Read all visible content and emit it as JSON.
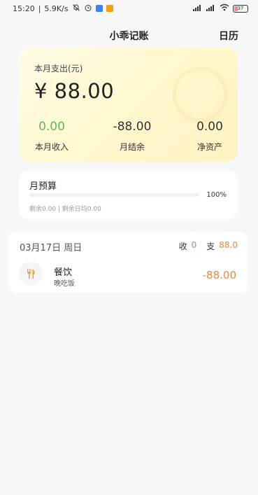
{
  "status_bar": {
    "time": "15:20",
    "speed": "5.9K/s",
    "battery_text": "37",
    "battery_level": 0.37,
    "app_colors": [
      "#3b82f6",
      "#f59e0b"
    ]
  },
  "header": {
    "title": "小乖记账",
    "calendar_label": "日历"
  },
  "summary": {
    "label": "本月支出(元)",
    "amount": "¥ 88.00",
    "income_value": "0.00",
    "income_label": "本月收入",
    "balance_value": "-88.00",
    "balance_label": "月结余",
    "net_value": "0.00",
    "net_label": "净资产"
  },
  "budget": {
    "title": "月预算",
    "percent_text": "100%",
    "progress": 1.0,
    "sub": "剩余0.00 | 剩余日均0.00"
  },
  "day_group": {
    "date": "03月17日  周日",
    "income_label": "收",
    "income_value": "0",
    "expense_label": "支",
    "expense_value": "88.0",
    "entries": [
      {
        "category": "餐饮",
        "note": "晚吃饭",
        "amount": "-88.00",
        "icon": "utensils-icon"
      }
    ]
  },
  "colors": {
    "income": "#5cb85c",
    "expense": "#e88a3a"
  }
}
